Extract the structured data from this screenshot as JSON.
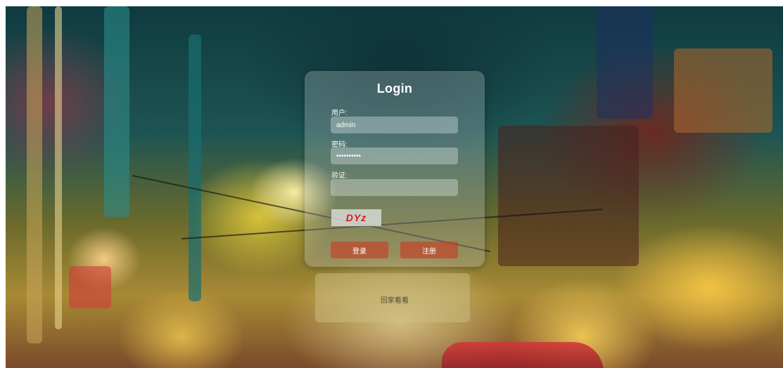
{
  "login": {
    "title": "Login",
    "username_label": "用户:",
    "username_value": "admin",
    "password_label": "密码:",
    "password_value": "••••••••••",
    "verify_label": "验证:",
    "verify_value": "",
    "captcha_text": "DYz",
    "login_button": "登录",
    "register_button": "注册"
  },
  "footer_note": "回家看看",
  "colors": {
    "card_bg": "rgba(190,200,200,0.30)",
    "button_bg": "#c83c23",
    "captcha_text": "#d71a1a"
  }
}
